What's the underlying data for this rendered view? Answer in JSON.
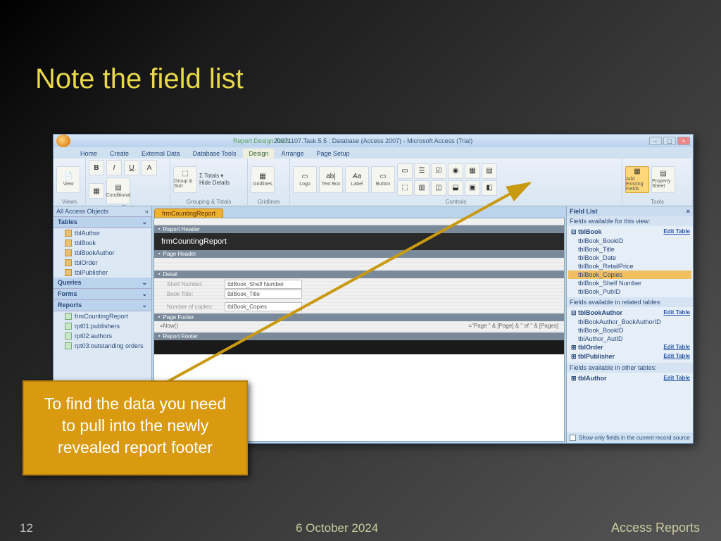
{
  "slide": {
    "title": "Note the field list",
    "page_number": "12",
    "date": "6 October 2024",
    "footer_right": "Access Reports",
    "callout": "To find the data you need to pull into the newly revealed report footer"
  },
  "app": {
    "title_center": "20071107.Task.5.5 : Database (Access 2007) - Microsoft Access (Trial)",
    "title_tools": "Report Design Tools",
    "tabs": [
      "Home",
      "Create",
      "External Data",
      "Database Tools",
      "Design",
      "Arrange",
      "Page Setup"
    ],
    "active_tab": "Design",
    "ribbon_groups": {
      "views": "Views",
      "font": "Font",
      "grouping": "Grouping & Totals",
      "gridlines": "Gridlines",
      "controls": "Controls",
      "tools": "Tools",
      "view": "View",
      "conditional": "Conditional",
      "group_sort": "Group & Sort",
      "totals": "Σ Totals ▾",
      "hide_details": "Hide Details",
      "gridlines_btn": "Gridlines",
      "logo": "Logo",
      "textbox": "Text Box",
      "label": "Label",
      "button": "Button",
      "add_fields": "Add Existing Fields",
      "prop_sheet": "Property Sheet",
      "aa": "Aa",
      "ab": "ab|"
    },
    "nav": {
      "header": "All Access Objects",
      "categories": {
        "tables": "Tables",
        "queries": "Queries",
        "forms": "Forms",
        "reports": "Reports"
      },
      "tables": [
        "tblAuthor",
        "tblBook",
        "tblBookAuthor",
        "tblOrder",
        "tblPublisher"
      ],
      "reports": [
        "frmCountingReport",
        "rpt01:publishers",
        "rpt02:authors",
        "rpt03:outstanding orders"
      ]
    },
    "doc_tab": "frmCountingReport",
    "bands": {
      "report_header": "Report Header",
      "report_title": "frmCountingReport",
      "page_header": "Page Header",
      "detail": "Detail",
      "page_footer": "Page Footer",
      "report_footer": "Report Footer"
    },
    "detail_fields": {
      "lbl_shelf": "Shelf Number:",
      "val_shelf": "tblBook_Shelf Number",
      "lbl_title": "Book Title:",
      "val_title": "tblBook_Title",
      "lbl_copies": "Number of copies:",
      "val_copies": "tblBook_Copies"
    },
    "page_footer": {
      "now": "=Now()",
      "pages": "=\"Page \" & [Page] & \" of \" & [Pages]"
    },
    "field_list": {
      "title": "Field List",
      "sec1": "Fields available for this view:",
      "root1": "tblBook",
      "edit": "Edit Table",
      "fields1": [
        "tblBook_BookID",
        "tblBook_Title",
        "tblBook_Date",
        "tblBook_RetailPrice",
        "tblBook_Copies",
        "tblBook_Shelf Number",
        "tblBook_PubID"
      ],
      "selected": "tblBook_Copies",
      "sec2": "Fields available in related tables:",
      "root2": "tblBookAuthor",
      "fields2": [
        "tblBookAuthor_BookAuthorID",
        "tblBook_BookID",
        "tblAuthor_AutID"
      ],
      "rel_others": [
        "tblOrder",
        "tblPublisher"
      ],
      "sec3": "Fields available in other tables:",
      "root3": "tblAuthor",
      "footer": "Show only fields in the current record source"
    }
  }
}
